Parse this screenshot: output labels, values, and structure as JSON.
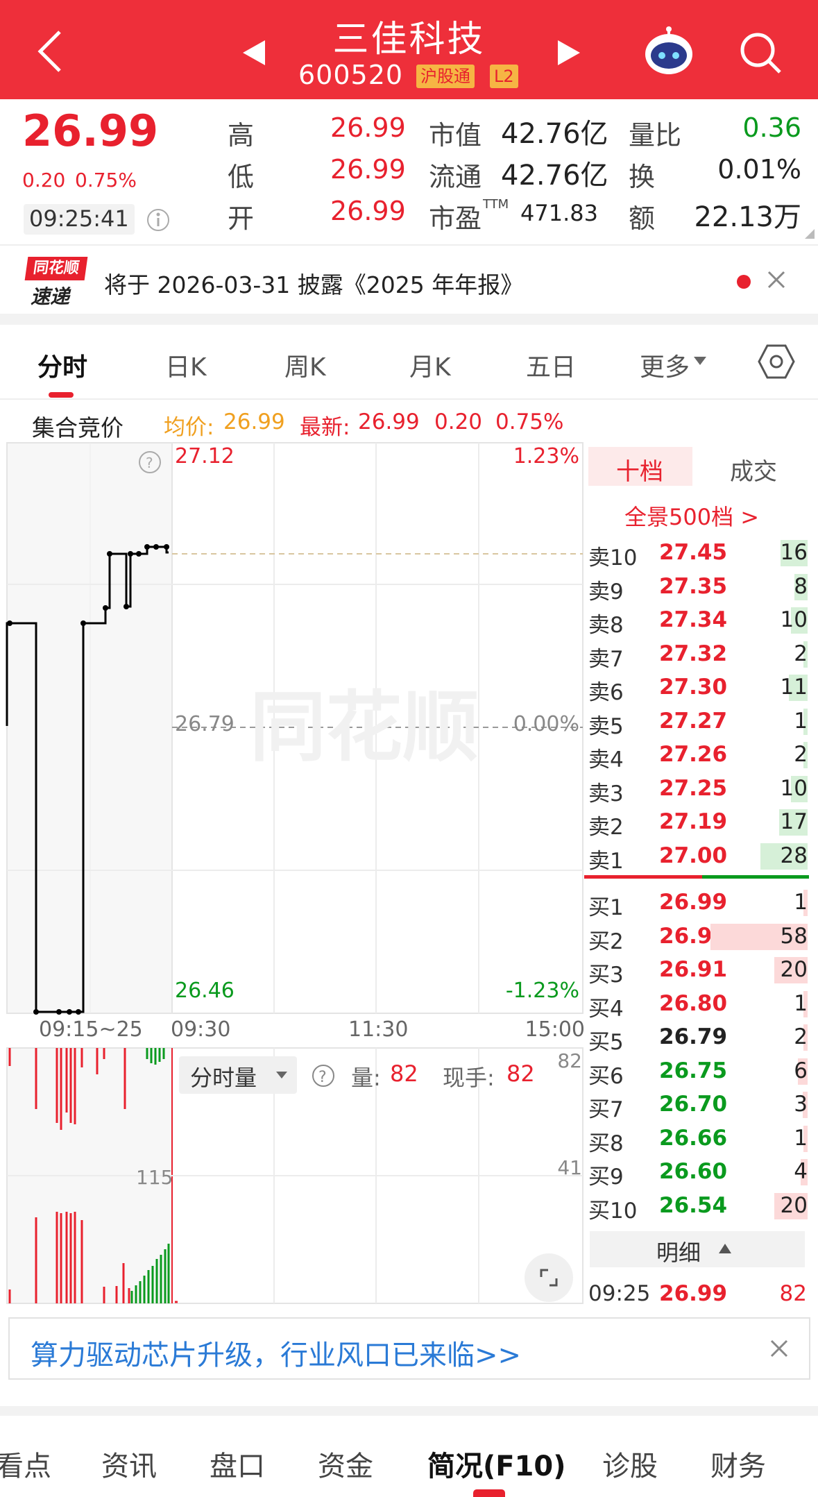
{
  "header": {
    "title": "三佳科技",
    "code": "600520",
    "tag1": "沪股通",
    "tag2": "L2"
  },
  "quote": {
    "price": "26.99",
    "change": "0.20",
    "pct": "0.75%",
    "time": "09:25:41",
    "high_label": "高",
    "high": "26.99",
    "low_label": "低",
    "low": "26.99",
    "open_label": "开",
    "open": "26.99",
    "mcap_label": "市值",
    "mcap": "42.76亿",
    "float_label": "流通",
    "float": "42.76亿",
    "pe_label": "市盈",
    "pe_sup": "TTM",
    "pe": "471.83",
    "vr_label": "量比",
    "vr": "0.36",
    "turn_label": "换",
    "turn": "0.01%",
    "amt_label": "额",
    "amt": "22.13万"
  },
  "news": {
    "logo_top": "同花顺",
    "logo_bottom": "速递",
    "text": "将于 2026-03-31 披露《2025 年年报》"
  },
  "tabs": [
    "分时",
    "日K",
    "周K",
    "月K",
    "五日",
    "更多"
  ],
  "chart": {
    "label": "集合竞价",
    "avg_label": "均价:",
    "avg": "26.99",
    "last_label": "最新:",
    "last": "26.99",
    "chg": "0.20",
    "pct": "0.75%",
    "y_top": "27.12",
    "y_top_pct": "1.23%",
    "y_mid": "26.79",
    "y_mid_pct": "0.00%",
    "y_bot": "26.46",
    "y_bot_pct": "-1.23%",
    "x_auction": "09:15~25",
    "x_open": "09:30",
    "x_mid": "11:30",
    "x_close": "15:00",
    "vol_label": "分时量",
    "vol_name": "量:",
    "vol": "82",
    "hand_name": "现手:",
    "hand": "82",
    "vol_top": "82",
    "vol_mid": "41",
    "auction_vol": "115",
    "watermark": "同花顺"
  },
  "orderbook": {
    "tab1": "十档",
    "tab2": "成交",
    "full": "全景500档 >",
    "asks": [
      {
        "label": "卖10",
        "price": "27.45",
        "vol": "16"
      },
      {
        "label": "卖9",
        "price": "27.35",
        "vol": "8"
      },
      {
        "label": "卖8",
        "price": "27.34",
        "vol": "10"
      },
      {
        "label": "卖7",
        "price": "27.32",
        "vol": "2"
      },
      {
        "label": "卖6",
        "price": "27.30",
        "vol": "11"
      },
      {
        "label": "卖5",
        "price": "27.27",
        "vol": "1"
      },
      {
        "label": "卖4",
        "price": "27.26",
        "vol": "2"
      },
      {
        "label": "卖3",
        "price": "27.25",
        "vol": "10"
      },
      {
        "label": "卖2",
        "price": "27.19",
        "vol": "17"
      },
      {
        "label": "卖1",
        "price": "27.00",
        "vol": "28"
      }
    ],
    "bids": [
      {
        "label": "买1",
        "price": "26.99",
        "vol": "1"
      },
      {
        "label": "买2",
        "price": "26.93",
        "vol": "58"
      },
      {
        "label": "买3",
        "price": "26.91",
        "vol": "20"
      },
      {
        "label": "买4",
        "price": "26.80",
        "vol": "1"
      },
      {
        "label": "买5",
        "price": "26.79",
        "vol": "2"
      },
      {
        "label": "买6",
        "price": "26.75",
        "vol": "6"
      },
      {
        "label": "买7",
        "price": "26.70",
        "vol": "3"
      },
      {
        "label": "买8",
        "price": "26.66",
        "vol": "1"
      },
      {
        "label": "买9",
        "price": "26.60",
        "vol": "4"
      },
      {
        "label": "买10",
        "price": "26.54",
        "vol": "20"
      }
    ],
    "detail": "明细",
    "tick_time": "09:25",
    "tick_price": "26.99",
    "tick_vol": "82"
  },
  "banner": {
    "text": "算力驱动芯片升级，行业风口已来临>>"
  },
  "bottom_tabs": [
    "看点",
    "资讯",
    "盘口",
    "资金",
    "简况(F10)",
    "诊股",
    "财务"
  ],
  "colors": {
    "brand": "#ee2f3a",
    "up": "#e8212e",
    "down": "#0a9a1e",
    "avg": "#f0a020",
    "link": "#2a7ad6"
  }
}
